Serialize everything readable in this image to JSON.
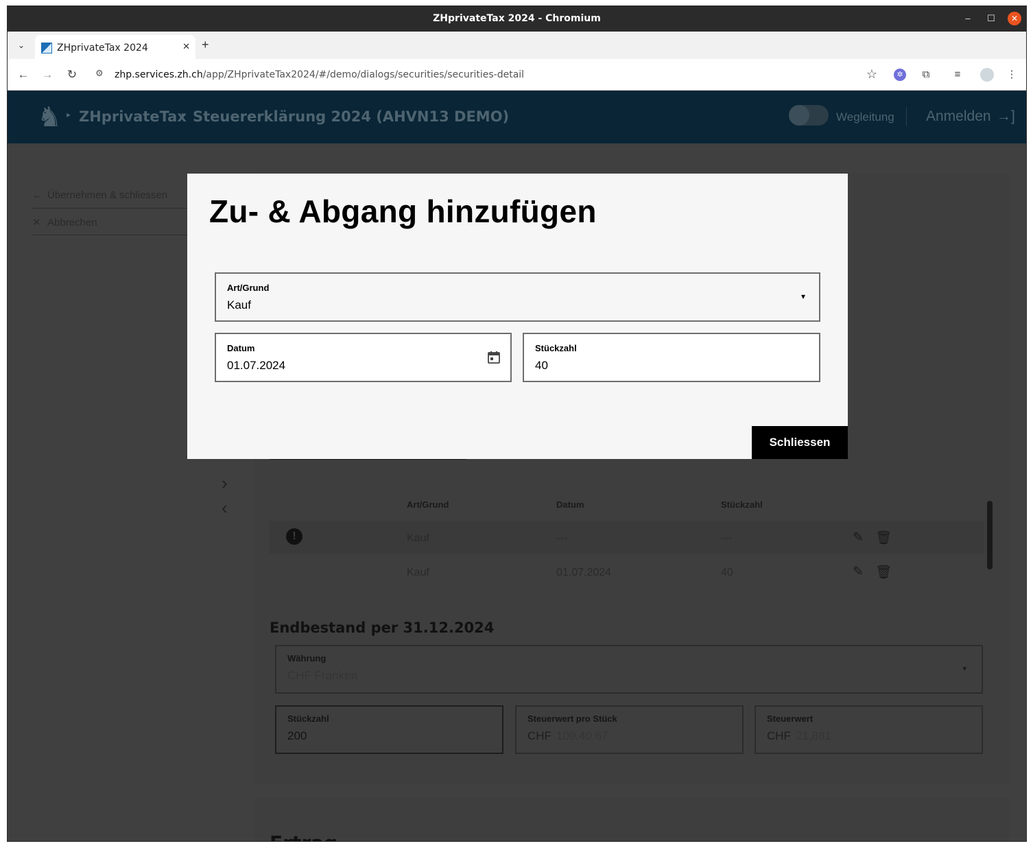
{
  "window": {
    "title": "ZHprivateTax 2024 - Chromium",
    "minimize_icon": "–",
    "maximize_icon": "☐",
    "close_icon": "✕"
  },
  "browser": {
    "tab_title": "ZHprivateTax 2024",
    "tab_close_icon": "✕",
    "new_tab_icon": "+",
    "tab_list_icon": "⌄",
    "url_host": "zhp.services.zh.ch",
    "url_path": "/app/ZHprivateTax2024/#/demo/dialogs/securities/securities-detail",
    "back_icon": "←",
    "forward_icon": "→",
    "reload_icon": "↻",
    "site_info_icon": "⚙",
    "bookmark_icon": "☆",
    "extensions_icon": "⧉",
    "media_icon": "≡",
    "menu_icon": "⋮"
  },
  "app_header": {
    "brand": "ZHprivateTax",
    "crumb_separator": "▸",
    "page": "Steuererklärung 2024 (AHVN13 DEMO)",
    "guidance_label": "Wegleitung",
    "login_label": "Anmelden",
    "login_icon": "→]",
    "logo_glyph": "♞"
  },
  "sidebar": {
    "apply_label": "Übernehmen & schliessen",
    "apply_icon": "←",
    "cancel_label": "Abbrechen",
    "cancel_icon": "✕"
  },
  "pager": {
    "next_icon": "›",
    "prev_icon": "‹"
  },
  "transactions": {
    "columns": [
      "Art/Grund",
      "Datum",
      "Stückzahl"
    ],
    "rows": [
      {
        "type": "Kauf",
        "date": "---",
        "quantity": "---",
        "warning_icon": "!"
      },
      {
        "type": "Kauf",
        "date": "01.07.2024",
        "quantity": "40"
      }
    ],
    "edit_icon": "✎",
    "delete_icon": "🗑"
  },
  "end_balance": {
    "title": "Endbestand per 31.12.2024",
    "currency": {
      "label": "Währung",
      "value": "CHF Franken",
      "caret": "▾"
    },
    "quantity": {
      "label": "Stückzahl",
      "value": "200"
    },
    "tax_value_per_unit": {
      "label": "Steuerwert pro Stück",
      "currency": "CHF",
      "value": "109.40.67"
    },
    "tax_value": {
      "label": "Steuerwert",
      "currency": "CHF",
      "value": "21,881"
    }
  },
  "next_section_title": "Ertrag",
  "dialog": {
    "title": "Zu- & Abgang hinzufügen",
    "type_field": {
      "label": "Art/Grund",
      "value": "Kauf",
      "caret": "▾"
    },
    "date_field": {
      "label": "Datum",
      "value": "01.07.2024"
    },
    "quantity_field": {
      "label": "Stückzahl",
      "value": "40"
    },
    "close_label": "Schliessen"
  }
}
